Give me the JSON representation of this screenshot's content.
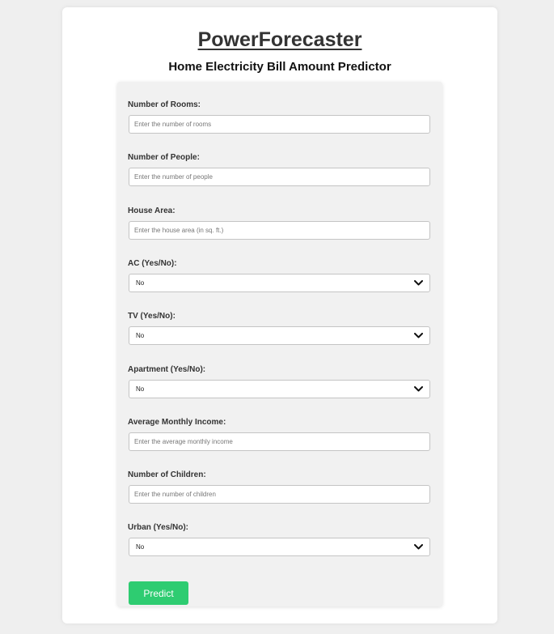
{
  "app": {
    "title": "PowerForecaster",
    "subtitle": "Home Electricity Bill Amount Predictor"
  },
  "colors": {
    "page_background": "#efefef",
    "card_background": "#ffffff",
    "panel_background": "#f1f1f1",
    "accent_button": "#2ecc71"
  },
  "form": {
    "rooms": {
      "label": "Number of Rooms:",
      "placeholder": "Enter the number of rooms",
      "value": ""
    },
    "people": {
      "label": "Number of People:",
      "placeholder": "Enter the number of people",
      "value": ""
    },
    "area": {
      "label": "House Area:",
      "placeholder": "Enter the house area (in sq. ft.)",
      "value": ""
    },
    "ac": {
      "label": "AC (Yes/No):",
      "selected": "No",
      "icon": "chevron-down-icon"
    },
    "tv": {
      "label": "TV (Yes/No):",
      "selected": "No",
      "icon": "chevron-down-icon"
    },
    "apartment": {
      "label": "Apartment (Yes/No):",
      "selected": "No",
      "icon": "chevron-down-icon"
    },
    "income": {
      "label": "Average Monthly Income:",
      "placeholder": "Enter the average monthly income",
      "value": ""
    },
    "children": {
      "label": "Number of Children:",
      "placeholder": "Enter the number of children",
      "value": ""
    },
    "urban": {
      "label": "Urban (Yes/No):",
      "selected": "No",
      "icon": "chevron-down-icon"
    },
    "submit_label": "Predict"
  }
}
